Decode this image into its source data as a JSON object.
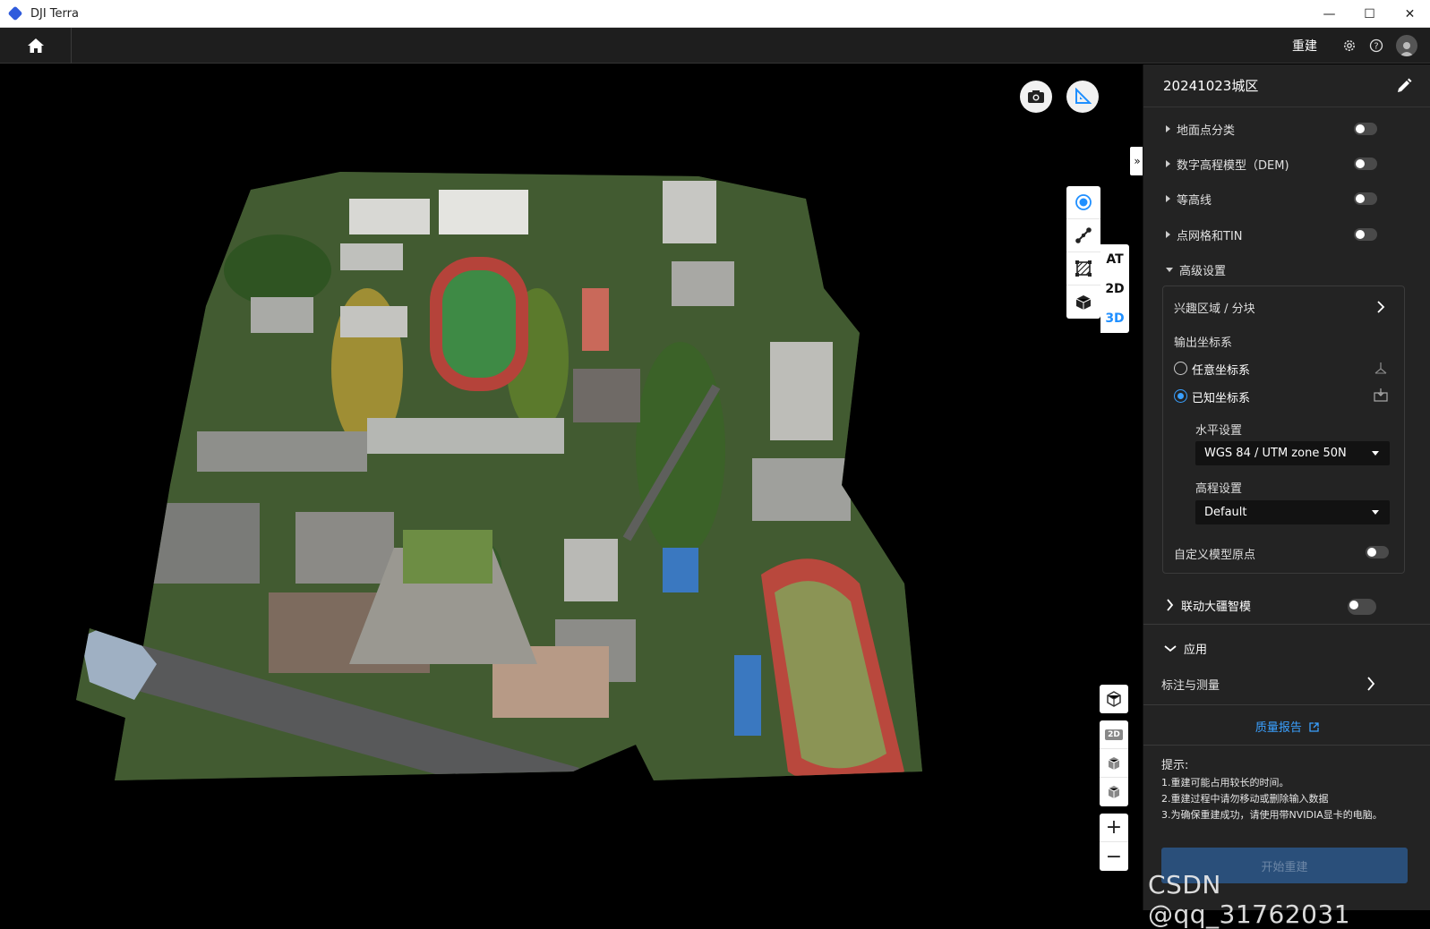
{
  "window": {
    "title": "DJI Terra",
    "minimize": "—",
    "maximize": "☐",
    "close": "✕"
  },
  "topbar": {
    "rebuild_label": "重建"
  },
  "viewport": {
    "mode_buttons": [
      "AT",
      "2D",
      "3D"
    ],
    "active_mode": "3D",
    "view_2d_badge": "2D",
    "zoom_in": "+",
    "zoom_out": "−"
  },
  "panel": {
    "project_name": "20241023城区",
    "options": [
      {
        "label": "地面点分类",
        "enabled": false
      },
      {
        "label": "数字高程模型（DEM)",
        "enabled": false
      },
      {
        "label": "等高线",
        "enabled": false
      },
      {
        "label": "点网格和TIN",
        "enabled": false
      }
    ],
    "advanced": {
      "title": "高级设置",
      "roi_label": "兴趣区域 / 分块",
      "output_cs_label": "输出坐标系",
      "arbitrary_cs": "任意坐标系",
      "known_cs": "已知坐标系",
      "selected_cs": "已知坐标系",
      "horizontal_label": "水平设置",
      "horizontal_value": "WGS 84 / UTM zone 50N",
      "elevation_label": "高程设置",
      "elevation_value": "Default",
      "custom_origin_label": "自定义模型原点",
      "custom_origin_enabled": false
    },
    "linked_modeling": {
      "label": "联动大疆智模",
      "enabled": false
    },
    "apply": {
      "title": "应用",
      "annotation_label": "标注与测量"
    },
    "quality_report": "质量报告",
    "tips": {
      "title": "提示:",
      "lines": [
        "1.重建可能占用较长的时间。",
        "2.重建过程中请勿移动或删除输入数据",
        "3.为确保重建成功，请使用带NVIDIA显卡的电脑。"
      ]
    },
    "start_button": "开始重建"
  },
  "watermark": "CSDN @qq_31762031",
  "colors": {
    "accent": "#3aa0ff",
    "panel_bg": "#232323",
    "viewport_bg": "#000000"
  }
}
